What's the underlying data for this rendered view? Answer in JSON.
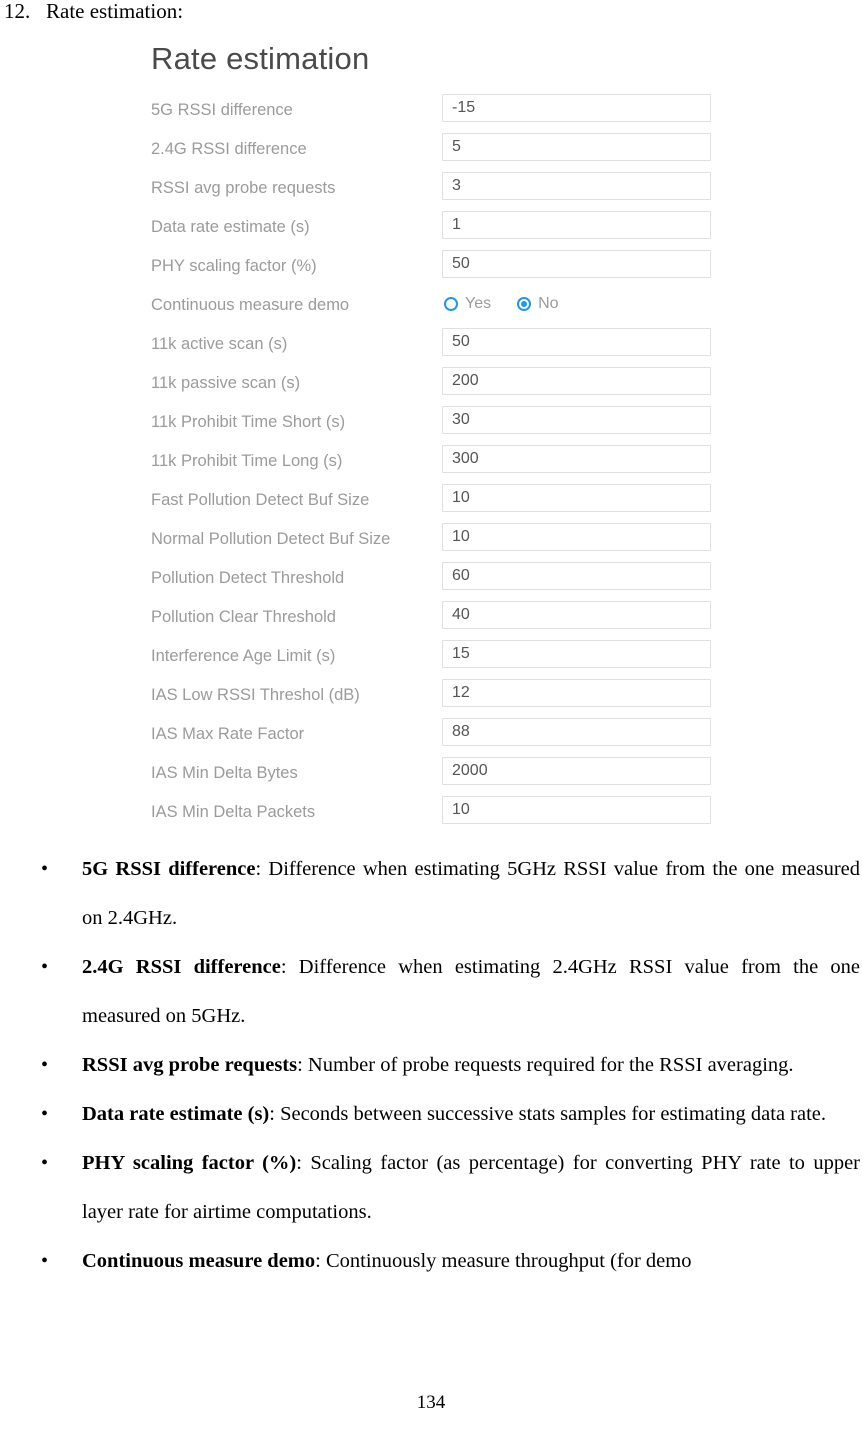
{
  "document": {
    "heading_number": "12.",
    "heading_text": "Rate estimation:",
    "page_number": "134"
  },
  "ui_panel": {
    "title": "Rate estimation",
    "fields": [
      {
        "label": "5G RSSI difference",
        "type": "text",
        "value": "-15"
      },
      {
        "label": "2.4G RSSI difference",
        "type": "text",
        "value": "5"
      },
      {
        "label": "RSSI avg probe requests",
        "type": "text",
        "value": "3"
      },
      {
        "label": "Data rate estimate (s)",
        "type": "text",
        "value": "1"
      },
      {
        "label": "PHY scaling factor (%)",
        "type": "text",
        "value": "50"
      },
      {
        "label": "Continuous measure demo",
        "type": "radio",
        "options": [
          "Yes",
          "No"
        ],
        "selected": "No"
      },
      {
        "label": "11k active scan (s)",
        "type": "text",
        "value": "50"
      },
      {
        "label": "11k passive scan (s)",
        "type": "text",
        "value": "200"
      },
      {
        "label": "11k Prohibit Time Short (s)",
        "type": "text",
        "value": "30"
      },
      {
        "label": "11k Prohibit Time Long (s)",
        "type": "text",
        "value": "300"
      },
      {
        "label": "Fast Pollution Detect Buf Size",
        "type": "text",
        "value": "10"
      },
      {
        "label": "Normal Pollution Detect Buf Size",
        "type": "text",
        "value": "10"
      },
      {
        "label": "Pollution Detect Threshold",
        "type": "text",
        "value": "60"
      },
      {
        "label": "Pollution Clear Threshold",
        "type": "text",
        "value": "40"
      },
      {
        "label": "Interference Age Limit (s)",
        "type": "text",
        "value": "15"
      },
      {
        "label": "IAS Low RSSI Threshol (dB)",
        "type": "text",
        "value": "12"
      },
      {
        "label": "IAS Max Rate Factor",
        "type": "text",
        "value": "88"
      },
      {
        "label": "IAS Min Delta Bytes",
        "type": "text",
        "value": "2000"
      },
      {
        "label": "IAS Min Delta Packets",
        "type": "text",
        "value": "10"
      }
    ],
    "colors": {
      "label_gray": "#9b9b9b",
      "value_gray": "#555555",
      "border_gray": "#e0e0e0",
      "title_gray": "#4a4a4a",
      "radio_blue": "#2196f3"
    }
  },
  "descriptions": [
    {
      "term": "5G RSSI difference",
      "text": ": Difference when estimating 5GHz RSSI value from the one measured on 2.4GHz."
    },
    {
      "term": "2.4G RSSI difference",
      "text": ": Difference when estimating 2.4GHz RSSI value from the one measured on 5GHz."
    },
    {
      "term": "RSSI avg probe requests",
      "text": ": Number of probe requests required for the RSSI averaging."
    },
    {
      "term": "Data rate estimate (s)",
      "text": ": Seconds between successive stats samples for estimating data rate."
    },
    {
      "term": "PHY scaling factor (%)",
      "text": ": Scaling factor (as percentage) for converting PHY rate to upper layer rate for airtime computations."
    },
    {
      "term": "Continuous measure demo",
      "text": ": Continuously measure throughput (for demo"
    }
  ]
}
